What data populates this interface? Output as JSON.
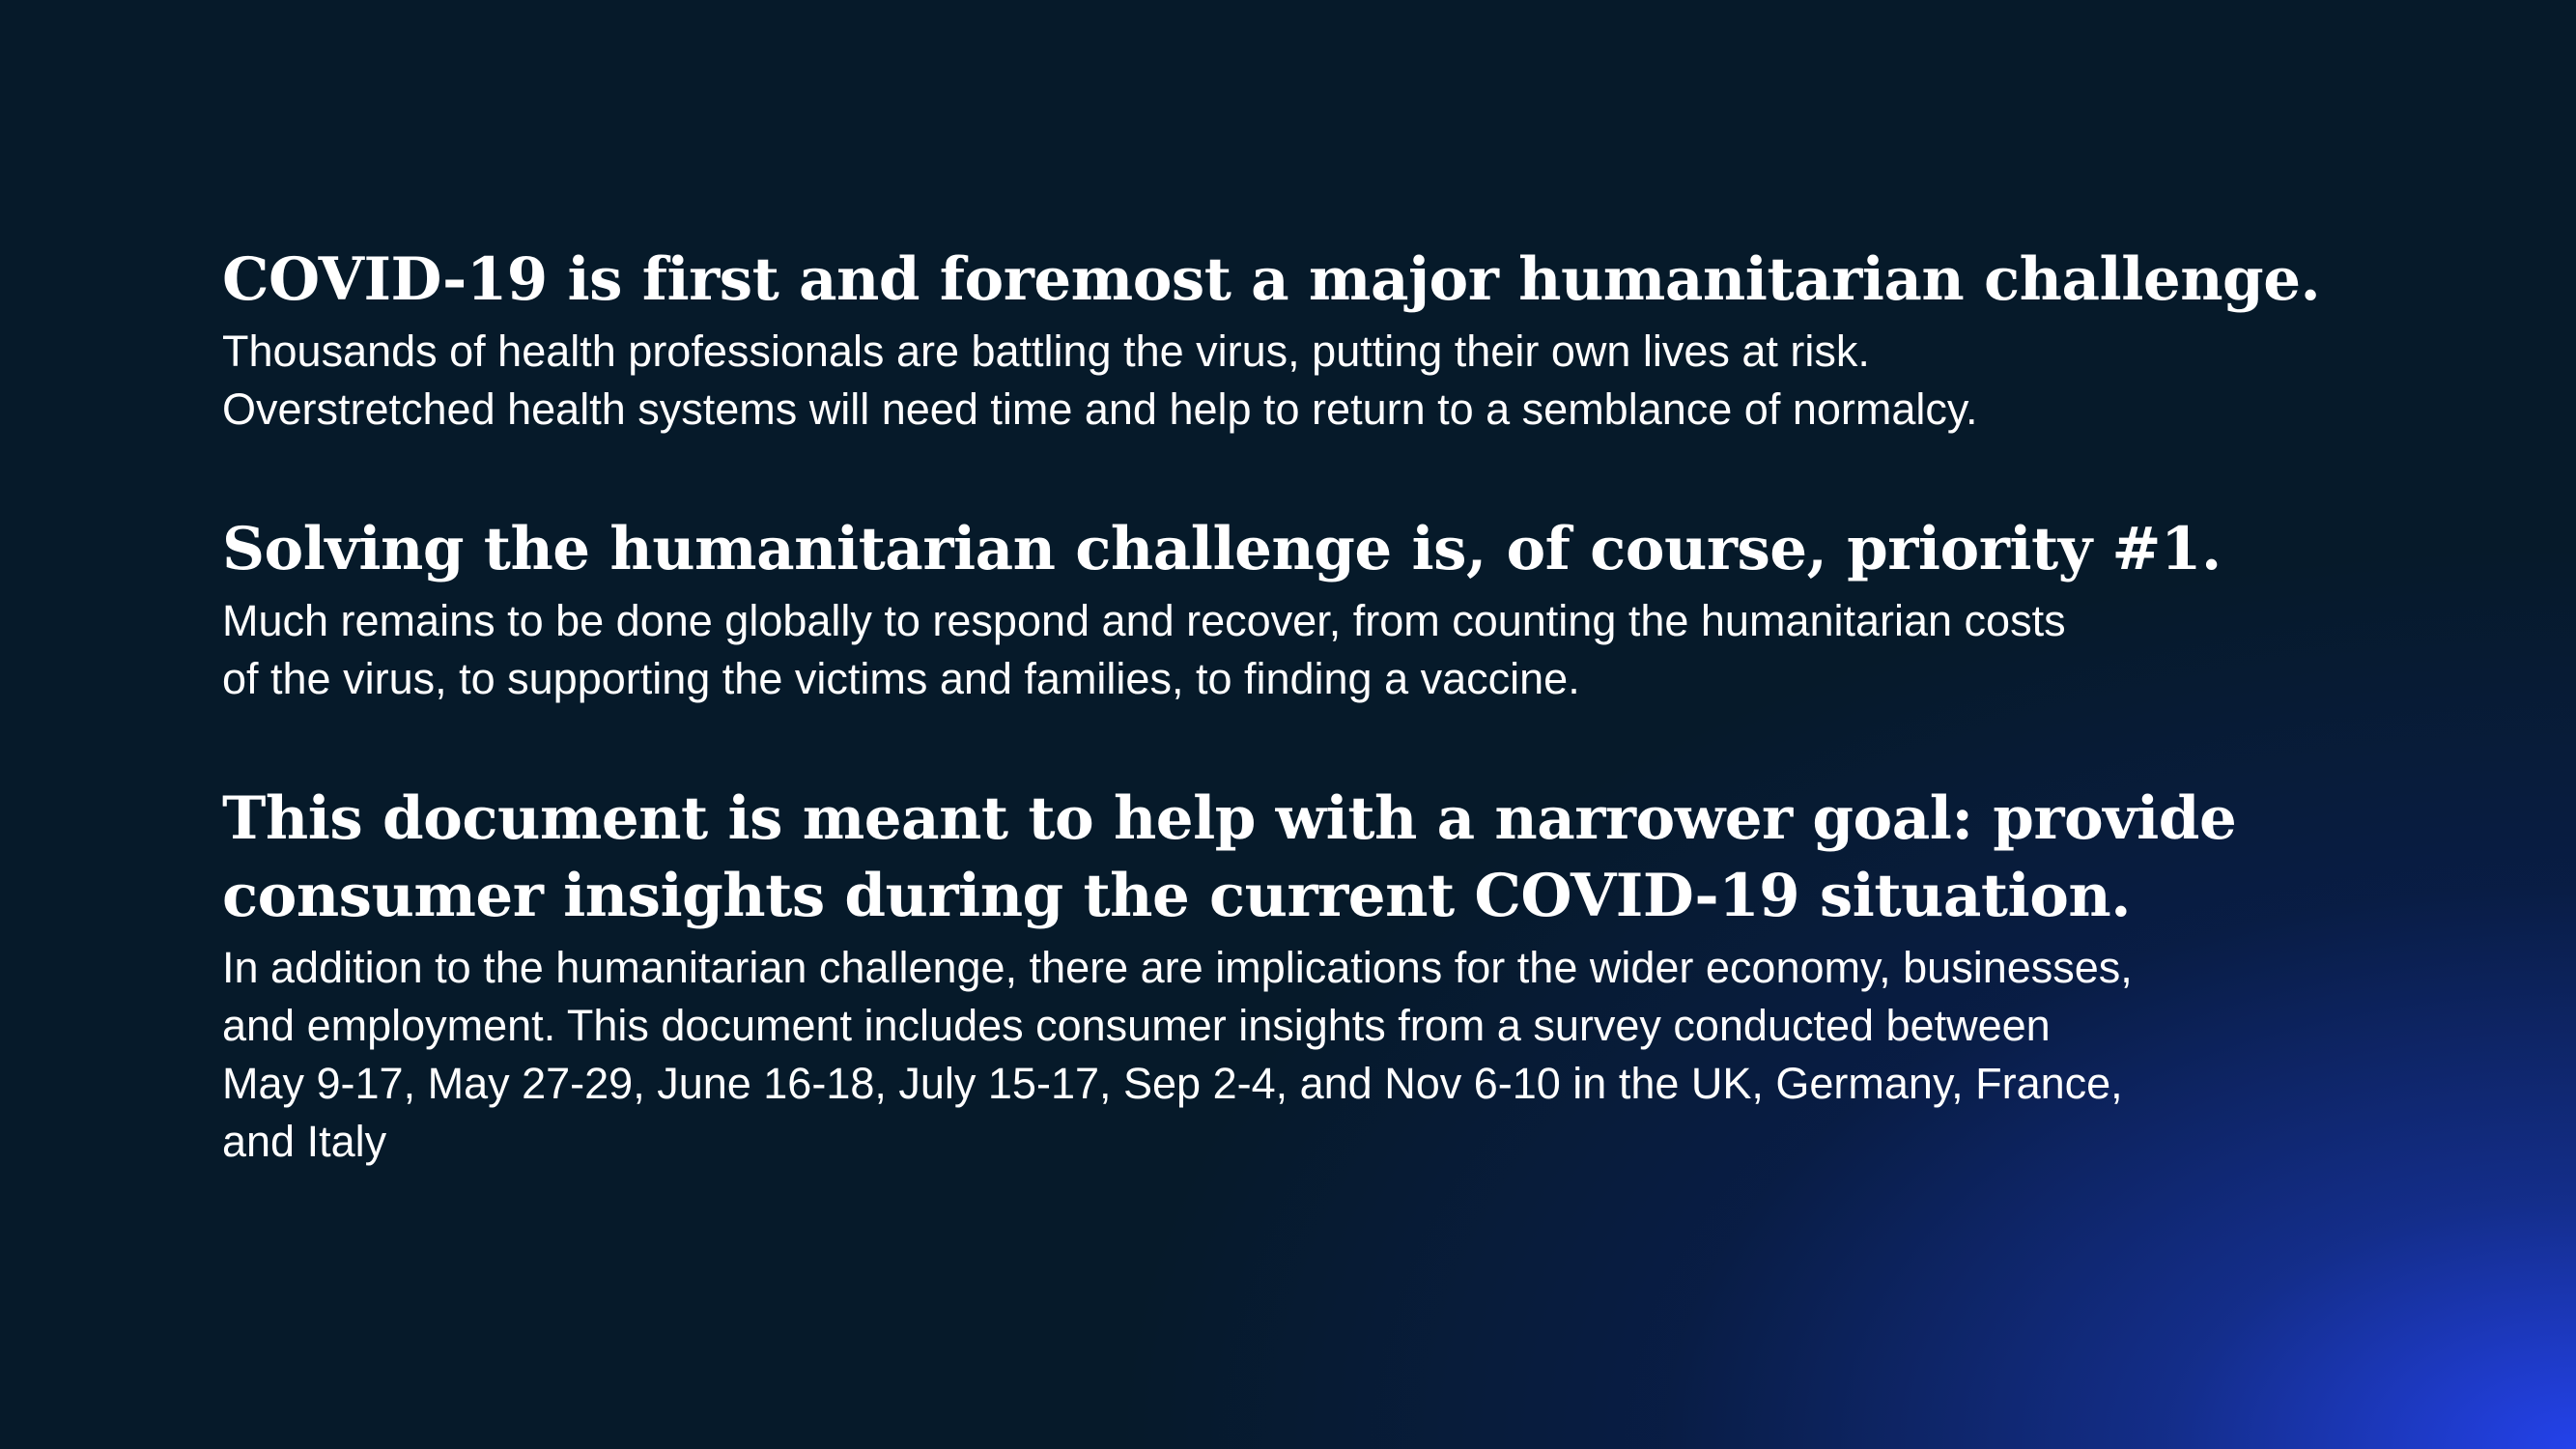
{
  "colors": {
    "background": "#061a2a",
    "gradient_accent": "#2442eb",
    "text": "#ffffff"
  },
  "sections": [
    {
      "heading_lines": [
        "COVID-19 is first and foremost a major humanitarian challenge."
      ],
      "body_lines": [
        "Thousands of health professionals are battling the virus, putting their own lives at risk.",
        "Overstretched health systems will need time and help to return to a semblance of normalcy."
      ]
    },
    {
      "heading_lines": [
        "Solving the humanitarian challenge is, of course, priority #1."
      ],
      "body_lines": [
        "Much remains to be done globally to respond and recover, from counting the humanitarian costs",
        "of the virus, to supporting the victims and families, to finding a vaccine."
      ]
    },
    {
      "heading_lines": [
        "This document is meant to help with a narrower goal: provide",
        "consumer insights during the current COVID-19 situation."
      ],
      "body_lines": [
        "In addition to the humanitarian challenge, there are implications for the wider economy, businesses,",
        "and employment. This document includes consumer insights from a survey conducted between",
        "May 9-17, May 27-29, June 16-18, July 15-17, Sep 2-4, and Nov 6-10 in the UK, Germany, France,",
        "and Italy"
      ]
    }
  ]
}
